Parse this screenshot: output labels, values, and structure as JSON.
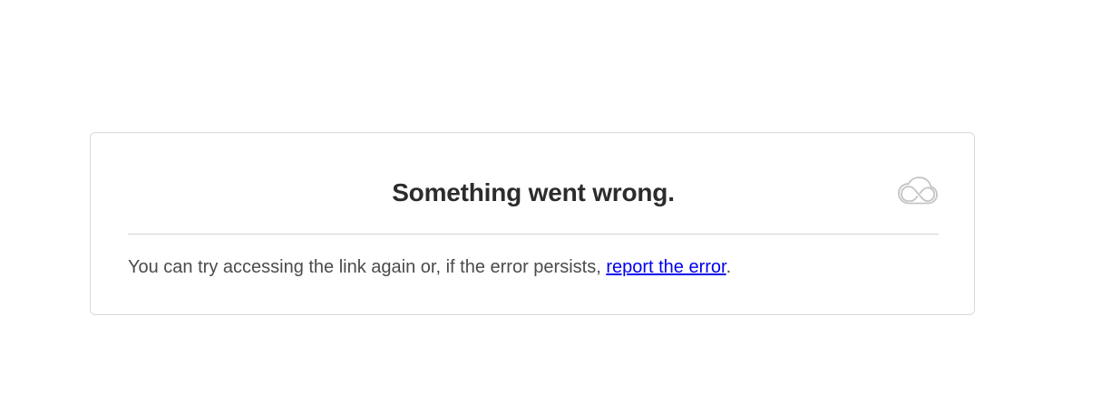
{
  "card": {
    "title": "Something went wrong.",
    "icon": "creative-cloud-icon",
    "message_prefix": "You can try accessing the link again or, if the error persists, ",
    "link_label": "report the error",
    "message_suffix": "."
  },
  "colors": {
    "title": "#2c2c2c",
    "body_text": "#4b4b4b",
    "link": "#0000ee",
    "border": "#d9d9d9",
    "icon_stroke": "#c4c4c4"
  }
}
